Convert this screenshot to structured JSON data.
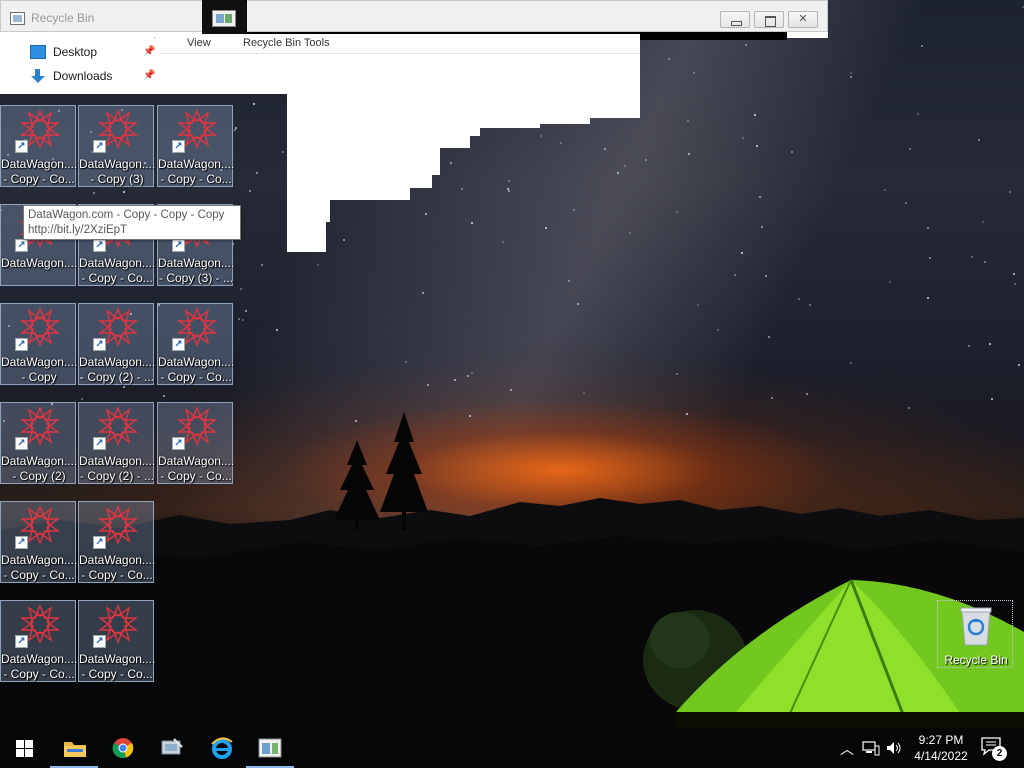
{
  "window": {
    "title": "Recycle Bin",
    "ribbon_tabs": [
      "View",
      "Recycle Bin Tools"
    ]
  },
  "nav_pane": {
    "items": [
      {
        "label": "Desktop",
        "icon": "desktop-icon"
      },
      {
        "label": "Downloads",
        "icon": "downloads-icon"
      }
    ]
  },
  "desktop_icons": [
    {
      "line1": "DataWagon....",
      "line2": "- Copy - Co..."
    },
    {
      "line1": "DataWagon....",
      "line2": "- Copy (3)"
    },
    {
      "line1": "DataWagon....",
      "line2": "- Copy - Co..."
    },
    {
      "line1": "DataWagon....",
      "line2": ""
    },
    {
      "line1": "DataWagon....",
      "line2": "- Copy - Co..."
    },
    {
      "line1": "DataWagon....",
      "line2": "- Copy (3) - ..."
    },
    {
      "line1": "DataWagon....",
      "line2": "- Copy"
    },
    {
      "line1": "DataWagon....",
      "line2": "- Copy (2) - ..."
    },
    {
      "line1": "DataWagon....",
      "line2": "- Copy - Co..."
    },
    {
      "line1": "DataWagon....",
      "line2": "- Copy (2)"
    },
    {
      "line1": "DataWagon....",
      "line2": "- Copy (2) - ..."
    },
    {
      "line1": "DataWagon....",
      "line2": "- Copy - Co..."
    },
    {
      "line1": "DataWagon....",
      "line2": "- Copy - Co..."
    },
    {
      "line1": "DataWagon....",
      "line2": "- Copy - Co..."
    },
    {
      "line1": "DataWagon....",
      "line2": "- Copy - Co..."
    },
    {
      "line1": "DataWagon....",
      "line2": "- Copy - Co..."
    }
  ],
  "tooltip": {
    "line1": "DataWagon.com - Copy - Copy - Copy",
    "line2": "http://bit.ly/2XziEpT"
  },
  "recycle_bin": {
    "label": "Recycle Bin",
    "icon": "recycle-bin-icon"
  },
  "taskbar": {
    "apps": [
      {
        "name": "start-button",
        "icon": "windows-logo-icon"
      },
      {
        "name": "file-explorer",
        "icon": "folder-icon"
      },
      {
        "name": "chrome",
        "icon": "chrome-icon"
      },
      {
        "name": "network-app",
        "icon": "network-icon"
      },
      {
        "name": "internet-explorer",
        "icon": "ie-icon"
      },
      {
        "name": "recycle-bin-window",
        "icon": "window-icon"
      }
    ],
    "time": "9:27 PM",
    "date": "4/14/2022",
    "notification_count": "2"
  },
  "colors": {
    "taskbar": "#050608",
    "selection": "#8fa3bd",
    "accent": "#8db7e6"
  }
}
